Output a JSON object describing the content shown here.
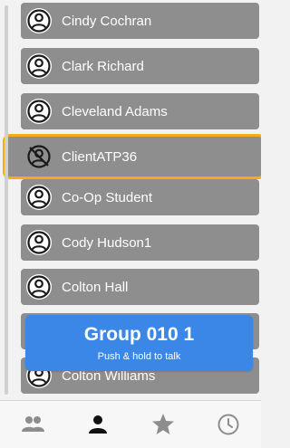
{
  "contacts": [
    {
      "name": "Cindy Cochran",
      "icon": "user-circle-icon"
    },
    {
      "name": "Clark Richard",
      "icon": "user-circle-icon"
    },
    {
      "name": "Cleveland Adams",
      "icon": "user-circle-icon"
    },
    {
      "name": "ClientATP36",
      "icon": "user-offline-icon",
      "selected": true
    },
    {
      "name": "Co-Op Student",
      "icon": "user-circle-icon"
    },
    {
      "name": "Cody Hudson1",
      "icon": "user-circle-icon"
    },
    {
      "name": "Colton Hall",
      "icon": "user-circle-icon"
    },
    {
      "name": "",
      "icon": "user-circle-icon"
    },
    {
      "name": "Colton Williams",
      "icon": "user-circle-icon"
    }
  ],
  "ptt": {
    "title": "Group 010 1",
    "subtitle": "Push & hold to talk"
  },
  "tabs": [
    {
      "icon": "groups-icon",
      "active": false
    },
    {
      "icon": "contact-icon",
      "active": true
    },
    {
      "icon": "star-icon",
      "active": false
    },
    {
      "icon": "clock-icon",
      "active": false
    }
  ],
  "colors": {
    "row_bg": "#8e8e8e",
    "highlight": "#f4ac17",
    "ptt_blue": "#3a87e8",
    "tab_active": "#111111",
    "tab_inactive": "#8d8d8d"
  }
}
